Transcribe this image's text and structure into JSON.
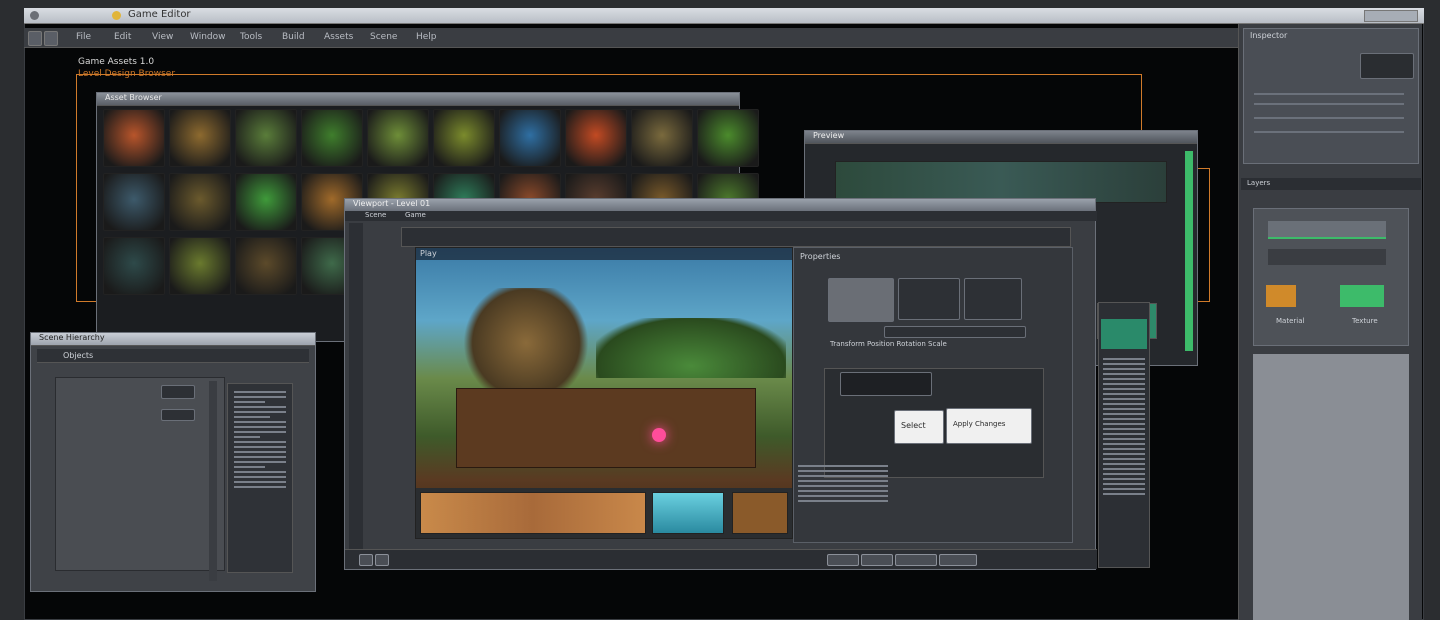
{
  "window": {
    "title": "Game Editor",
    "controls": [
      "close-icon",
      "minimize-icon",
      "maximize-icon"
    ]
  },
  "toolbar": {
    "items": [
      "File",
      "Edit",
      "View",
      "Window",
      "Tools",
      "Build",
      "Assets",
      "Scene",
      "Help"
    ]
  },
  "top_left_labels": {
    "line1": "Game Assets 1.0",
    "line2": "Level Design Browser"
  },
  "asset_browser": {
    "title": "Asset Browser",
    "thumbnail_colors": [
      "#b8552b",
      "#8d6a2f",
      "#5a7d3a",
      "#3f7e2c",
      "#6e8e38",
      "#7b8b2c",
      "#2f6fa3",
      "#c24a23",
      "#7a6a3d",
      "#4b8b2c",
      "#3d5a6b",
      "#6b5a2d",
      "#3f9a3a",
      "#a06a2a",
      "#7a7b2e",
      "#2e7d5a",
      "#8c4a2a",
      "#5a3d2e",
      "#7a5a2a",
      "#4c7a2c",
      "#2e4a4a",
      "#6a7a2e",
      "#5c4a2a",
      "#3f6a4a"
    ]
  },
  "left_panel": {
    "title": "Scene Hierarchy",
    "header": "Objects"
  },
  "viewport": {
    "title": "Viewport - Level 01",
    "tabs": [
      "Scene",
      "Game"
    ],
    "label": "Play",
    "properties_header": "Properties",
    "inspector_line": "Transform Position Rotation Scale",
    "button_left": "Select",
    "button_right": "Apply Changes"
  },
  "back_window": {
    "title": "Preview"
  },
  "right_panel": {
    "title": "Inspector",
    "section2": "Layers",
    "footer_left": "Material",
    "footer_right": "Texture"
  },
  "accent": "#d07a2a",
  "highlight_green": "#3dbb6a"
}
